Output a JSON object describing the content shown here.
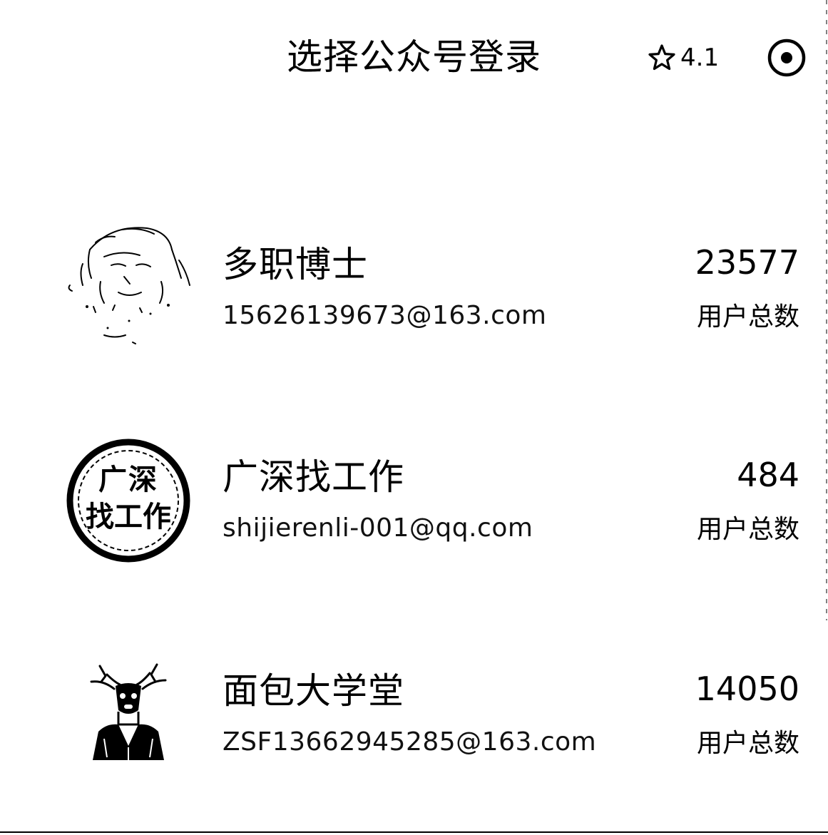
{
  "header": {
    "title": "选择公众号登录",
    "rating": "4.1",
    "rating_icon": "star-outline-icon",
    "action_icon": "target-icon"
  },
  "accounts": [
    {
      "name": "多职博士",
      "email": "15626139673@163.com",
      "count": "23577",
      "count_label": "用户总数",
      "avatar_icon": "sketch-portrait-avatar"
    },
    {
      "name": "广深找工作",
      "email": "shijierenli-001@qq.com",
      "count": "484",
      "count_label": "用户总数",
      "avatar_icon": "circular-seal-avatar",
      "avatar_text_line1": "广深",
      "avatar_text_line2": "找工作"
    },
    {
      "name": "面包大学堂",
      "email": "ZSF13662945285@163.com",
      "count": "14050",
      "count_label": "用户总数",
      "avatar_icon": "deer-in-jacket-avatar"
    }
  ]
}
